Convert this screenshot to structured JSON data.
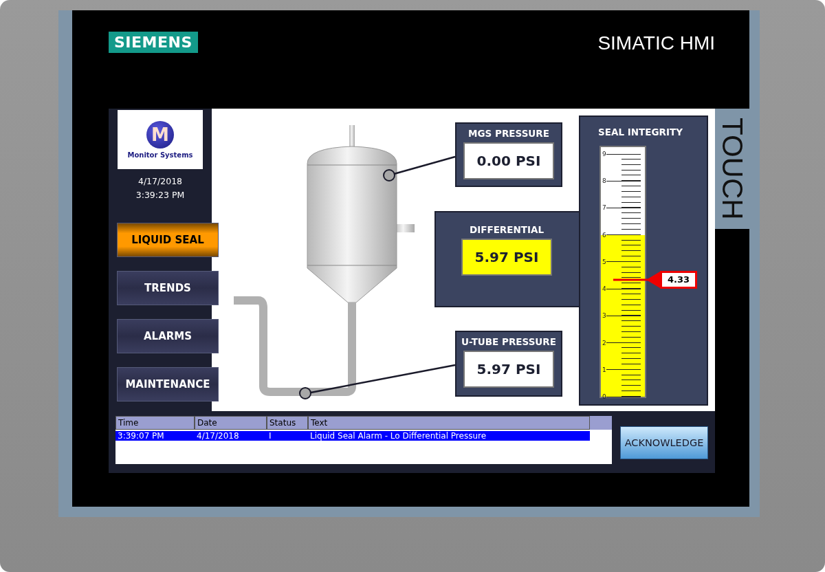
{
  "device": {
    "brand": "SIEMENS",
    "model": "SIMATIC HMI",
    "side_label": "TOUCH"
  },
  "logo": {
    "letter": "M",
    "name": "Monitor Systems"
  },
  "clock": {
    "date": "4/17/2018",
    "time": "3:39:23 PM"
  },
  "nav": [
    {
      "label": "LIQUID SEAL",
      "selected": true
    },
    {
      "label": "TRENDS",
      "selected": false
    },
    {
      "label": "ALARMS",
      "selected": false
    },
    {
      "label": "MAINTENANCE",
      "selected": false
    }
  ],
  "readouts": [
    {
      "kind": "mgs",
      "label": "MGS PRESSURE",
      "value": "0.00 PSI",
      "alarm": false
    },
    {
      "kind": "differential",
      "label": "DIFFERENTIAL",
      "value": "5.97 PSI",
      "alarm": true
    },
    {
      "kind": "utube",
      "label": "U-TUBE PRESSURE",
      "value": "5.97 PSI",
      "alarm": false
    }
  ],
  "seal_integrity": {
    "title": "SEAL INTEGRITY",
    "scale": [
      "9",
      "8",
      "7",
      "6",
      "5",
      "4",
      "3",
      "2",
      "1",
      "0"
    ],
    "fill": {
      "level": 0.667
    },
    "pointer": {
      "level": 0.481,
      "reading": "4.33"
    }
  },
  "alarms": {
    "columns": [
      "Time",
      "Date",
      "Status",
      "Text"
    ],
    "rows": [
      {
        "cells": [
          "3:39:07 PM",
          "4/17/2018",
          "I",
          "Liquid Seal Alarm - Lo Differential Pressure"
        ],
        "selected": true
      }
    ]
  },
  "acknowledge_button": "ACKNOWLEDGE"
}
